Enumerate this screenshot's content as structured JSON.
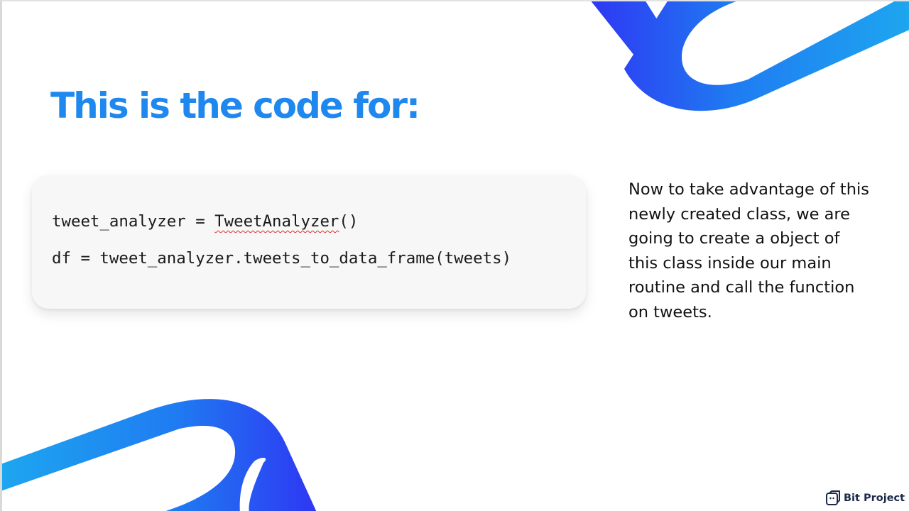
{
  "slide": {
    "title": "This is the code for:",
    "code": {
      "line1_prefix": "tweet_analyzer = ",
      "line1_flagged": "TweetAnalyzer",
      "line1_suffix": "()",
      "line2": "df = tweet_analyzer.tweets_to_data_frame(tweets)"
    },
    "description": "Now to take advantage of this newly created class, we are going to create a object of this class inside our main routine and call the function on tweets.",
    "brand": {
      "name": "Bit Project",
      "icon": "bit-project-logo-icon"
    }
  },
  "colors": {
    "title": "#1e88ef",
    "accent_blue": "#1c9bef",
    "accent_indigo": "#2f35f0",
    "code_background": "#f7f7f7",
    "text": "#111111"
  }
}
